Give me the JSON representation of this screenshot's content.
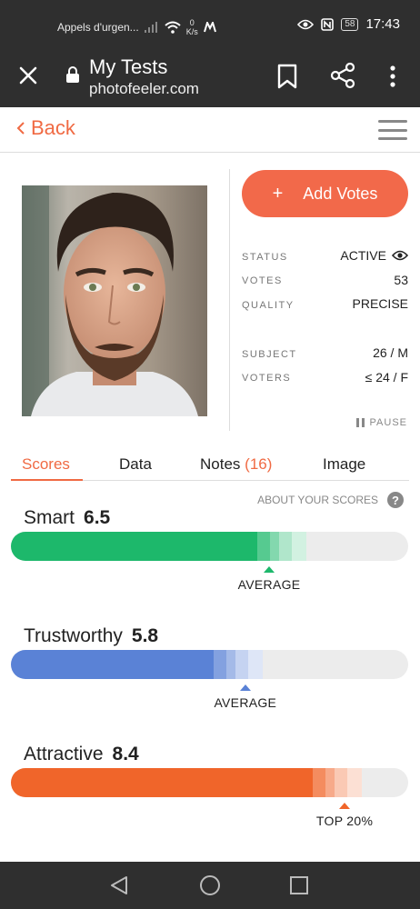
{
  "status_bar": {
    "carrier_text": "Appels d'urgen...",
    "net_speed_value": "0",
    "net_speed_unit": "K/s",
    "battery": "58",
    "time": "17:43"
  },
  "browser": {
    "title": "My Tests",
    "url": "photofeeler.com"
  },
  "header": {
    "back_label": "Back"
  },
  "actions": {
    "add_votes_label": "Add Votes"
  },
  "test_info": {
    "status_label": "STATUS",
    "status_value": "ACTIVE",
    "votes_label": "VOTES",
    "votes_value": "53",
    "quality_label": "QUALITY",
    "quality_value": "PRECISE",
    "subject_label": "SUBJECT",
    "subject_value": "26 / M",
    "voters_label": "VOTERS",
    "voters_value": "≤ 24 / F",
    "pause_label": "PAUSE"
  },
  "tabs": {
    "scores": "Scores",
    "data": "Data",
    "notes": "Notes",
    "notes_count": "(16)",
    "image": "Image"
  },
  "about_scores": "ABOUT YOUR SCORES",
  "scores": [
    {
      "name": "Smart",
      "value": "6.5",
      "marker": "AVERAGE",
      "fill_fraction": 0.62,
      "marker_fraction": 0.65,
      "color": "#1db86b"
    },
    {
      "name": "Trustworthy",
      "value": "5.8",
      "marker": "AVERAGE",
      "fill_fraction": 0.51,
      "marker_fraction": 0.59,
      "color": "#5a82d6"
    },
    {
      "name": "Attractive",
      "value": "8.4",
      "marker": "TOP 20%",
      "fill_fraction": 0.76,
      "marker_fraction": 0.84,
      "color": "#f0652a"
    }
  ],
  "icons": {
    "close": "close-icon",
    "lock": "lock-icon",
    "bookmark": "bookmark-icon",
    "share": "share-icon",
    "more": "more-vert-icon",
    "menu": "menu-icon",
    "eye": "eye-icon",
    "pause": "pause-icon",
    "help": "question-icon"
  }
}
